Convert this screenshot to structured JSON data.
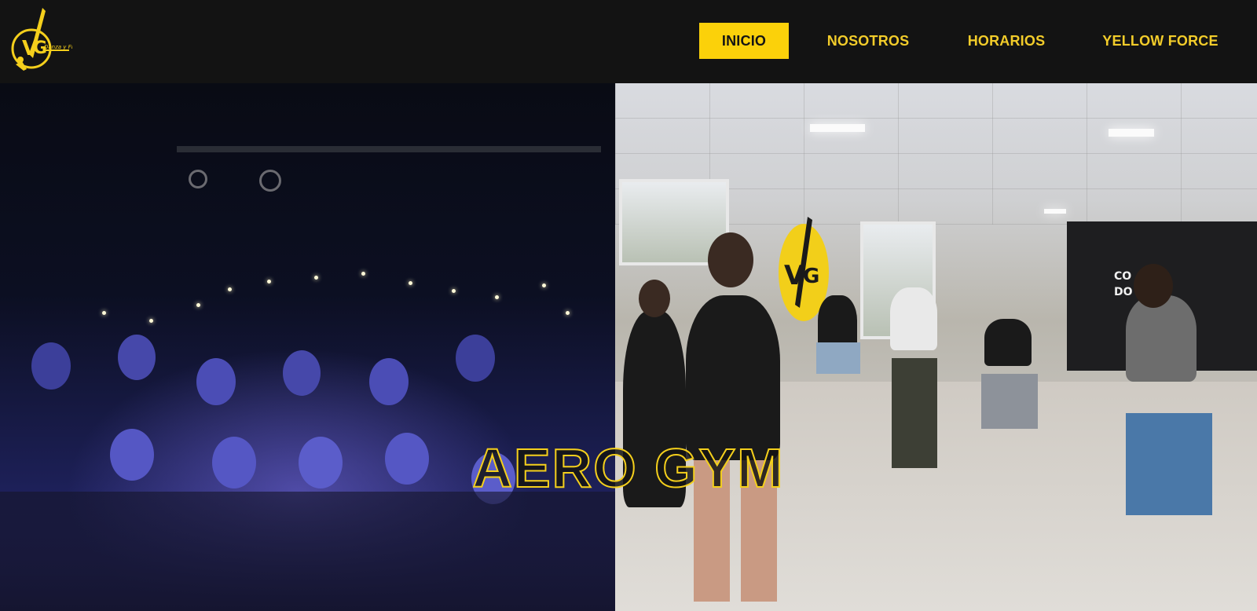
{
  "header": {
    "logo_icon": "vg-logo-icon",
    "logo_text": "Danza y Fitness",
    "accent_color": "#fbd10a",
    "nav": [
      {
        "label": "INICIO",
        "active": true
      },
      {
        "label": "NOSOTROS",
        "active": false
      },
      {
        "label": "HORARIOS",
        "active": false
      },
      {
        "label": "YELLOW FORCE",
        "active": false
      }
    ]
  },
  "hero": {
    "title": "AERO GYM",
    "left_image": "dance-show-crowd-photo",
    "right_image": "dance-studio-class-photo",
    "wall_sign": "CO  DIE\nDO"
  }
}
